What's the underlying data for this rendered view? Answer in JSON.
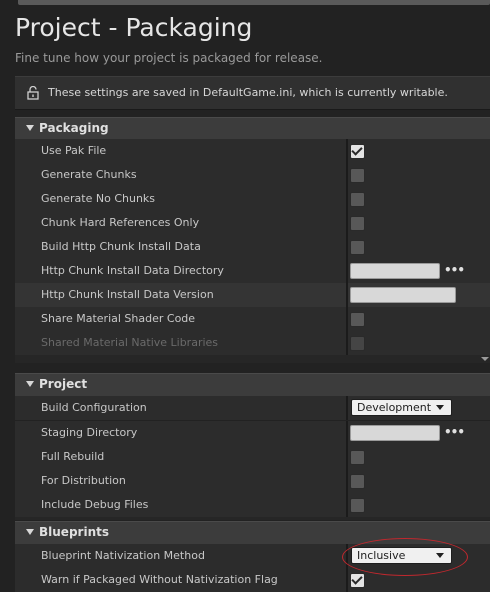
{
  "page": {
    "title": "Project - Packaging",
    "subtitle": "Fine tune how your project is packaged for release.",
    "notice": "These settings are saved in DefaultGame.ini, which is currently writable."
  },
  "sections": {
    "packaging": {
      "title": "Packaging",
      "rows": {
        "use_pak_file": {
          "label": "Use Pak File",
          "checked": true
        },
        "generate_chunks": {
          "label": "Generate Chunks",
          "checked": false
        },
        "generate_no_chunks": {
          "label": "Generate No Chunks",
          "checked": false
        },
        "chunk_hard_refs": {
          "label": "Chunk Hard References Only",
          "checked": false
        },
        "build_http_chunk": {
          "label": "Build Http Chunk Install Data",
          "checked": false
        },
        "http_chunk_dir": {
          "label": "Http Chunk Install Data Directory",
          "value": ""
        },
        "http_chunk_version": {
          "label": "Http Chunk Install Data Version",
          "value": ""
        },
        "share_material_shader": {
          "label": "Share Material Shader Code",
          "checked": false
        },
        "shared_material_native": {
          "label": "Shared Material Native Libraries",
          "checked": false,
          "disabled": true
        }
      }
    },
    "project": {
      "title": "Project",
      "rows": {
        "build_config": {
          "label": "Build Configuration",
          "value": "Development"
        },
        "staging_dir": {
          "label": "Staging Directory",
          "value": ""
        },
        "full_rebuild": {
          "label": "Full Rebuild",
          "checked": false
        },
        "for_distribution": {
          "label": "For Distribution",
          "checked": false
        },
        "include_debug": {
          "label": "Include Debug Files",
          "checked": false
        }
      }
    },
    "blueprints": {
      "title": "Blueprints",
      "rows": {
        "nativization_method": {
          "label": "Blueprint Nativization Method",
          "value": "Inclusive"
        },
        "warn_nativization": {
          "label": "Warn if Packaged Without Nativization Flag",
          "checked": true
        }
      }
    }
  },
  "icons": {
    "lock": "unlocked-padlock-icon",
    "browse": "ellipsis-icon",
    "collapse": "triangle-down-icon"
  },
  "colors": {
    "background": "#222222",
    "row": "#2c2c2c",
    "section_header": "#3c3c3c",
    "annotation_circle": "#c0282e"
  }
}
